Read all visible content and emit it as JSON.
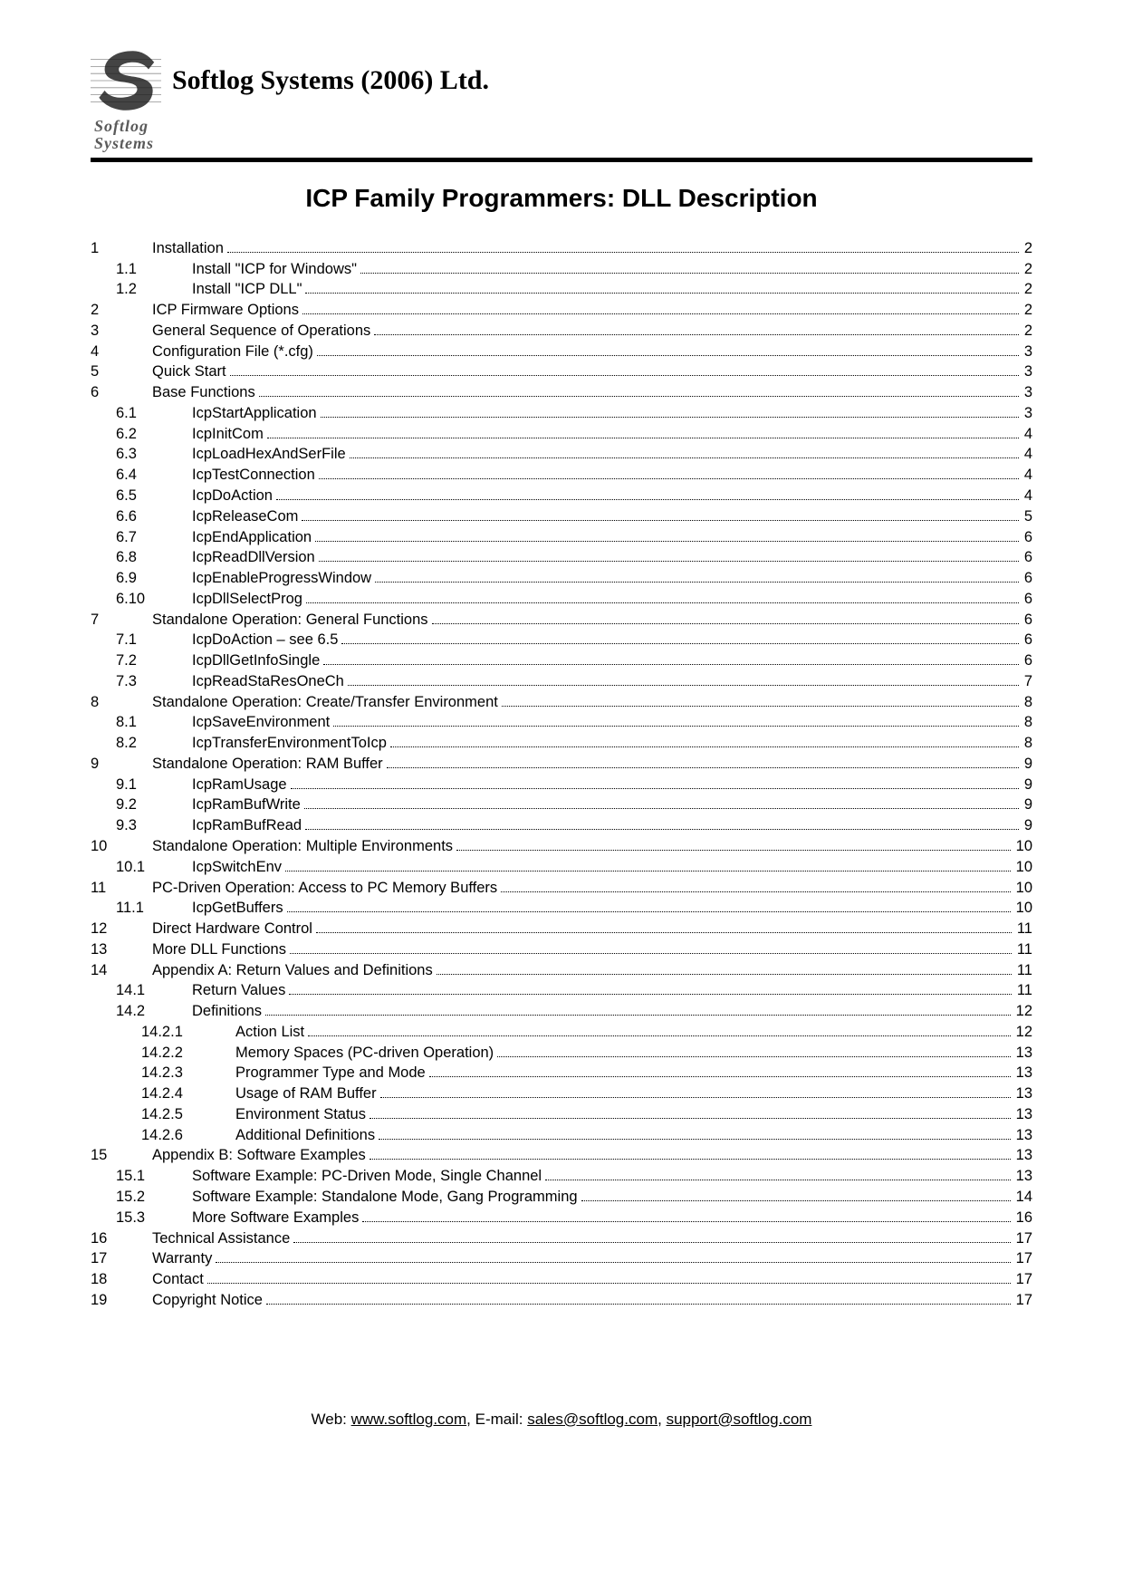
{
  "header": {
    "company_name": "Softlog Systems (2006) Ltd.",
    "logo_sub_line1": "Softlog",
    "logo_sub_line2": "Systems"
  },
  "doc_title": "ICP Family Programmers: DLL Description",
  "toc": [
    {
      "level": 1,
      "num": "1",
      "text": "Installation",
      "page": "2"
    },
    {
      "level": 2,
      "num": "1.1",
      "text": "Install \"ICP for Windows\"",
      "page": "2"
    },
    {
      "level": 2,
      "num": "1.2",
      "text": "Install \"ICP DLL\"",
      "page": "2"
    },
    {
      "level": 1,
      "num": "2",
      "text": "ICP Firmware Options",
      "page": "2"
    },
    {
      "level": 1,
      "num": "3",
      "text": "General Sequence of Operations",
      "page": "2"
    },
    {
      "level": 1,
      "num": "4",
      "text": "Configuration File (*.cfg)",
      "page": "3"
    },
    {
      "level": 1,
      "num": "5",
      "text": "Quick Start",
      "page": "3"
    },
    {
      "level": 1,
      "num": "6",
      "text": "Base Functions",
      "page": "3"
    },
    {
      "level": 2,
      "num": "6.1",
      "text": "IcpStartApplication",
      "page": "3"
    },
    {
      "level": 2,
      "num": "6.2",
      "text": "IcpInitCom",
      "page": "4"
    },
    {
      "level": 2,
      "num": "6.3",
      "text": "IcpLoadHexAndSerFile",
      "page": "4"
    },
    {
      "level": 2,
      "num": "6.4",
      "text": "IcpTestConnection",
      "page": "4"
    },
    {
      "level": 2,
      "num": "6.5",
      "text": "IcpDoAction",
      "page": "4"
    },
    {
      "level": 2,
      "num": "6.6",
      "text": "IcpReleaseCom",
      "page": "5"
    },
    {
      "level": 2,
      "num": "6.7",
      "text": "IcpEndApplication",
      "page": "6"
    },
    {
      "level": 2,
      "num": "6.8",
      "text": "IcpReadDllVersion",
      "page": "6"
    },
    {
      "level": 2,
      "num": "6.9",
      "text": "IcpEnableProgressWindow",
      "page": "6"
    },
    {
      "level": 2,
      "num": "6.10",
      "text": "IcpDllSelectProg",
      "page": "6"
    },
    {
      "level": 1,
      "num": "7",
      "text": "Standalone Operation: General Functions",
      "page": "6"
    },
    {
      "level": 2,
      "num": "7.1",
      "text": "IcpDoAction – see 6.5",
      "page": "6"
    },
    {
      "level": 2,
      "num": "7.2",
      "text": "IcpDllGetInfoSingle",
      "page": "6"
    },
    {
      "level": 2,
      "num": "7.3",
      "text": "IcpReadStaResOneCh",
      "page": "7"
    },
    {
      "level": 1,
      "num": "8",
      "text": "Standalone Operation: Create/Transfer Environment",
      "page": "8"
    },
    {
      "level": 2,
      "num": "8.1",
      "text": "IcpSaveEnvironment",
      "page": "8"
    },
    {
      "level": 2,
      "num": "8.2",
      "text": "IcpTransferEnvironmentToIcp",
      "page": "8"
    },
    {
      "level": 1,
      "num": "9",
      "text": "Standalone Operation: RAM Buffer",
      "page": "9"
    },
    {
      "level": 2,
      "num": "9.1",
      "text": "IcpRamUsage",
      "page": "9"
    },
    {
      "level": 2,
      "num": "9.2",
      "text": "IcpRamBufWrite",
      "page": "9"
    },
    {
      "level": 2,
      "num": "9.3",
      "text": "IcpRamBufRead",
      "page": "9"
    },
    {
      "level": 1,
      "num": "10",
      "text": "Standalone Operation: Multiple Environments",
      "page": "10"
    },
    {
      "level": 2,
      "num": "10.1",
      "text": "IcpSwitchEnv",
      "page": "10"
    },
    {
      "level": 1,
      "num": "11",
      "text": "PC-Driven Operation: Access to PC Memory Buffers",
      "page": "10"
    },
    {
      "level": 2,
      "num": "11.1",
      "text": "IcpGetBuffers",
      "page": "10"
    },
    {
      "level": 1,
      "num": "12",
      "text": "Direct Hardware Control",
      "page": "11"
    },
    {
      "level": 1,
      "num": "13",
      "text": "More DLL Functions",
      "page": "11"
    },
    {
      "level": 1,
      "num": "14",
      "text": "Appendix A: Return Values and Definitions",
      "page": "11"
    },
    {
      "level": 2,
      "num": "14.1",
      "text": "Return Values",
      "page": "11"
    },
    {
      "level": 2,
      "num": "14.2",
      "text": "Definitions",
      "page": "12"
    },
    {
      "level": 3,
      "num": "14.2.1",
      "text": "Action List",
      "page": "12"
    },
    {
      "level": 3,
      "num": "14.2.2",
      "text": "Memory Spaces (PC-driven Operation)",
      "page": "13"
    },
    {
      "level": 3,
      "num": "14.2.3",
      "text": "Programmer Type and Mode",
      "page": "13"
    },
    {
      "level": 3,
      "num": "14.2.4",
      "text": "Usage of RAM Buffer",
      "page": "13"
    },
    {
      "level": 3,
      "num": "14.2.5",
      "text": "Environment Status",
      "page": "13"
    },
    {
      "level": 3,
      "num": "14.2.6",
      "text": "Additional Definitions",
      "page": "13"
    },
    {
      "level": 1,
      "num": "15",
      "text": "Appendix B: Software Examples",
      "page": "13"
    },
    {
      "level": 2,
      "num": "15.1",
      "text": "Software Example: PC-Driven Mode, Single Channel",
      "page": "13"
    },
    {
      "level": 2,
      "num": "15.2",
      "text": "Software Example: Standalone Mode, Gang Programming",
      "page": "14"
    },
    {
      "level": 2,
      "num": "15.3",
      "text": "More Software Examples",
      "page": "16"
    },
    {
      "level": 1,
      "num": "16",
      "text": "Technical Assistance",
      "page": "17"
    },
    {
      "level": 1,
      "num": "17",
      "text": "Warranty",
      "page": "17"
    },
    {
      "level": 1,
      "num": "18",
      "text": "Contact",
      "page": "17"
    },
    {
      "level": 1,
      "num": "19",
      "text": "Copyright Notice",
      "page": "17"
    }
  ],
  "footer": {
    "web_label": "Web: ",
    "web_url": "www.softlog.com",
    "email_label": ", E-mail: ",
    "email1": "sales@softlog.com",
    "sep": ", ",
    "email2": "support@softlog.com"
  }
}
